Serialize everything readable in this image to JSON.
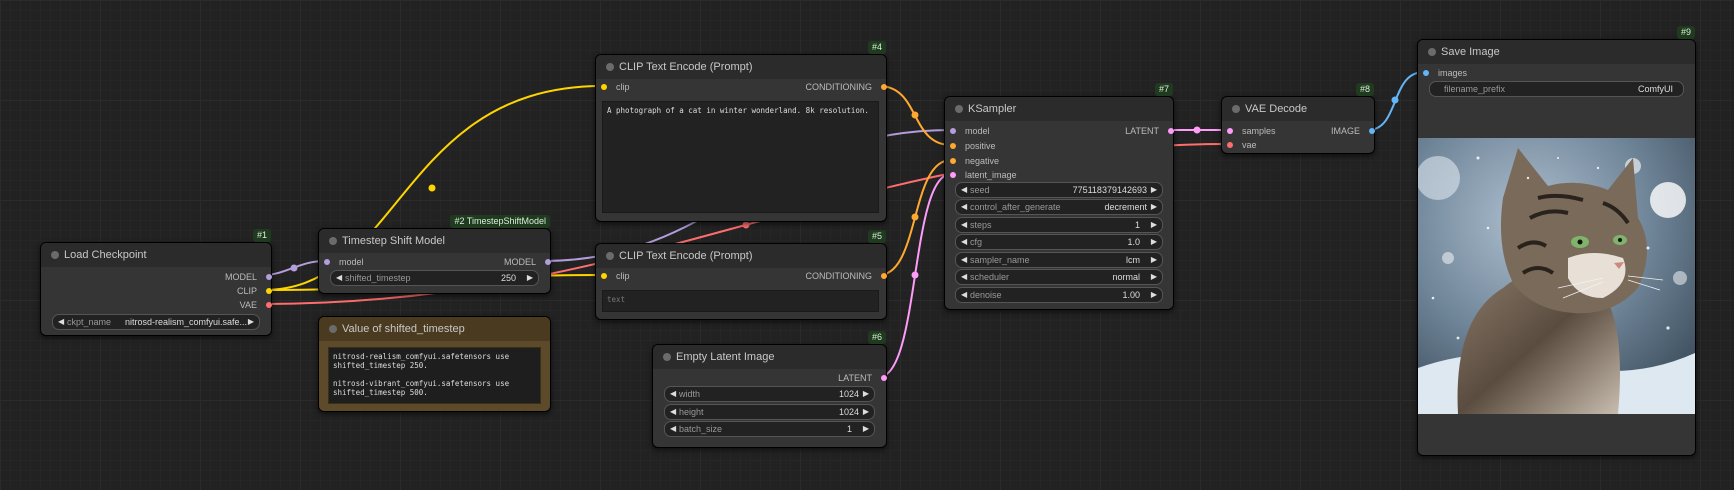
{
  "nodes": {
    "load_checkpoint": {
      "id": "#1",
      "title": "Load Checkpoint",
      "outputs": [
        "MODEL",
        "CLIP",
        "VAE"
      ],
      "ckpt_label": "ckpt_name",
      "ckpt_value": "nitrosd-realism_comfyui.safe..."
    },
    "timestep_shift": {
      "id": "#2 TimestepShiftModel",
      "title": "Timestep Shift Model",
      "input_model": "model",
      "output_model": "MODEL",
      "shift_label": "shifted_timestep",
      "shift_value": "250"
    },
    "value_note": {
      "title": "Value of shifted_timestep",
      "text": "nitrosd-realism_comfyui.safetensors use\nshifted_timestep 250.\n\nnitrosd-vibrant_comfyui.safetensors use\nshifted_timestep 500."
    },
    "clip_pos": {
      "id": "#4",
      "title": "CLIP Text Encode (Prompt)",
      "input": "clip",
      "output": "CONDITIONING",
      "text": "A photograph of a cat in winter wonderland. 8k resolution."
    },
    "clip_neg": {
      "id": "#5",
      "title": "CLIP Text Encode (Prompt)",
      "input": "clip",
      "output": "CONDITIONING",
      "placeholder": "text"
    },
    "empty_latent": {
      "id": "#6",
      "title": "Empty Latent Image",
      "output": "LATENT",
      "widgets": [
        {
          "label": "width",
          "value": "1024"
        },
        {
          "label": "height",
          "value": "1024"
        },
        {
          "label": "batch_size",
          "value": "1"
        }
      ]
    },
    "ksampler": {
      "id": "#7",
      "title": "KSampler",
      "inputs": [
        "model",
        "positive",
        "negative",
        "latent_image"
      ],
      "output": "LATENT",
      "widgets": [
        {
          "label": "seed",
          "value": "775118379142693"
        },
        {
          "label": "control_after_generate",
          "value": "decrement"
        },
        {
          "label": "steps",
          "value": "1"
        },
        {
          "label": "cfg",
          "value": "1.0"
        },
        {
          "label": "sampler_name",
          "value": "lcm"
        },
        {
          "label": "scheduler",
          "value": "normal"
        },
        {
          "label": "denoise",
          "value": "1.00"
        }
      ]
    },
    "vae_decode": {
      "id": "#8",
      "title": "VAE Decode",
      "inputs": [
        "samples",
        "vae"
      ],
      "output": "IMAGE"
    },
    "save_image": {
      "id": "#9",
      "title": "Save Image",
      "input": "images",
      "prefix_label": "filename_prefix",
      "prefix_value": "ComfyUI"
    }
  },
  "colors": {
    "model": "#b39ddb",
    "clip": "#ffd500",
    "vae": "#ff6e6e",
    "conditioning": "#ffa931",
    "latent": "#ff9cf9",
    "image": "#64b5f6"
  }
}
